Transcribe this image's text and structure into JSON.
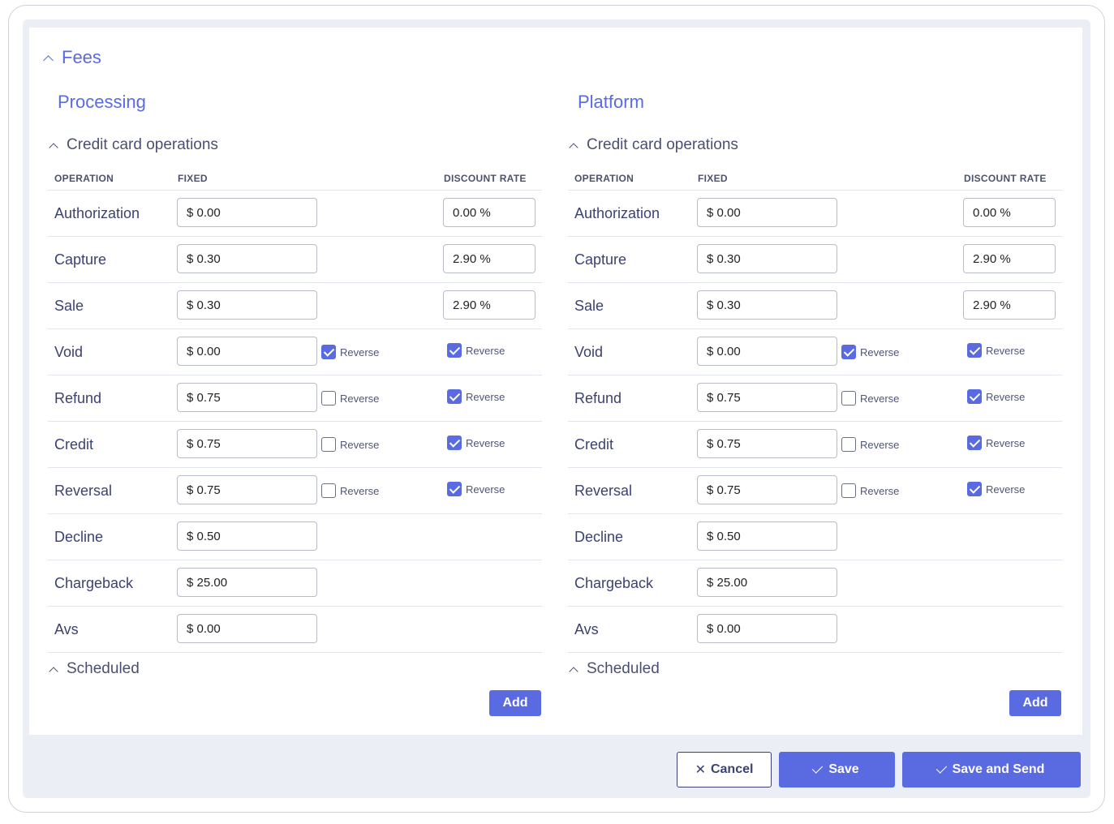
{
  "fees_label": "Fees",
  "columns": {
    "operation": "OPERATION",
    "fixed": "FIXED",
    "discount_rate": "DISCOUNT RATE"
  },
  "sub_label": "Credit card operations",
  "scheduled_label": "Scheduled",
  "add_label": "Add",
  "reverse_label": "Reverse",
  "sections": [
    {
      "title": "Processing",
      "rows": [
        {
          "op": "Authorization",
          "fixed": "$ 0.00",
          "rate": "0.00 %"
        },
        {
          "op": "Capture",
          "fixed": "$ 0.30",
          "rate": "2.90 %"
        },
        {
          "op": "Sale",
          "fixed": "$ 0.30",
          "rate": "2.90 %"
        },
        {
          "op": "Void",
          "fixed": "$ 0.00",
          "rev_fixed": true,
          "rev_rate": true
        },
        {
          "op": "Refund",
          "fixed": "$ 0.75",
          "rev_fixed": false,
          "rev_rate": true
        },
        {
          "op": "Credit",
          "fixed": "$ 0.75",
          "rev_fixed": false,
          "rev_rate": true
        },
        {
          "op": "Reversal",
          "fixed": "$ 0.75",
          "rev_fixed": false,
          "rev_rate": true
        },
        {
          "op": "Decline",
          "fixed": "$ 0.50"
        },
        {
          "op": "Chargeback",
          "fixed": "$ 25.00"
        },
        {
          "op": "Avs",
          "fixed": "$ 0.00"
        }
      ]
    },
    {
      "title": "Platform",
      "rows": [
        {
          "op": "Authorization",
          "fixed": "$ 0.00",
          "rate": "0.00 %"
        },
        {
          "op": "Capture",
          "fixed": "$ 0.30",
          "rate": "2.90 %"
        },
        {
          "op": "Sale",
          "fixed": "$ 0.30",
          "rate": "2.90 %"
        },
        {
          "op": "Void",
          "fixed": "$ 0.00",
          "rev_fixed": true,
          "rev_rate": true
        },
        {
          "op": "Refund",
          "fixed": "$ 0.75",
          "rev_fixed": false,
          "rev_rate": true
        },
        {
          "op": "Credit",
          "fixed": "$ 0.75",
          "rev_fixed": false,
          "rev_rate": true
        },
        {
          "op": "Reversal",
          "fixed": "$ 0.75",
          "rev_fixed": false,
          "rev_rate": true
        },
        {
          "op": "Decline",
          "fixed": "$ 0.50"
        },
        {
          "op": "Chargeback",
          "fixed": "$ 25.00"
        },
        {
          "op": "Avs",
          "fixed": "$ 0.00"
        }
      ]
    }
  ],
  "footer": {
    "cancel_label": "Cancel",
    "save_label": "Save",
    "save_send_label": "Save and Send"
  },
  "colors": {
    "accent": "#5a6ae0",
    "text": "#3c4270",
    "panel_bg": "#eceef5"
  }
}
